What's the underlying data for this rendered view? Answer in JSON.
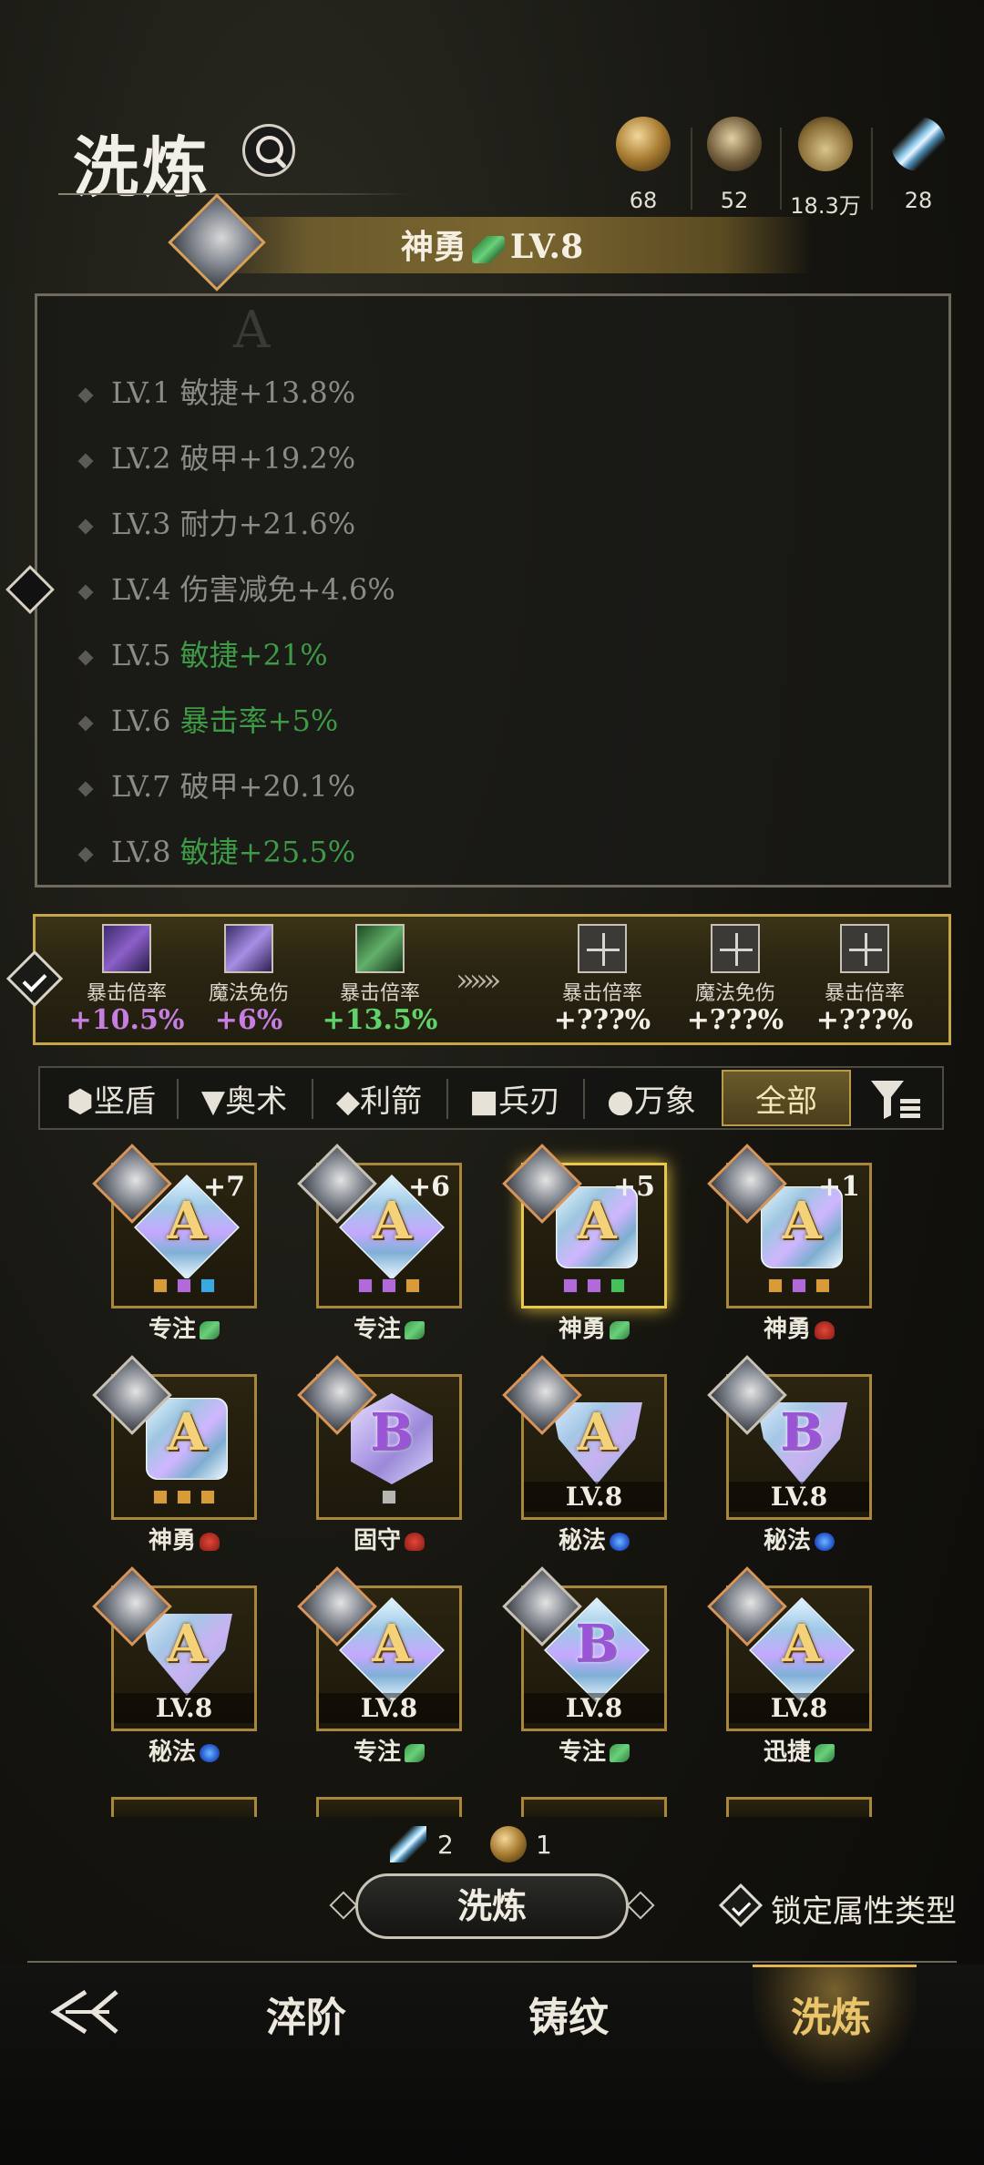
{
  "header": {
    "title": "洗炼"
  },
  "resources": [
    {
      "icon": "ore-gold-icon",
      "value": "68"
    },
    {
      "icon": "ore-dark-icon",
      "value": "52"
    },
    {
      "icon": "potion-icon",
      "value": "18.3万"
    },
    {
      "icon": "feather-icon",
      "value": "28"
    }
  ],
  "banner": {
    "name": "神勇",
    "level": "LV.8"
  },
  "stats": {
    "watermark": "A",
    "rows": [
      {
        "lv": "LV.1",
        "attr": "敏捷+13.8%",
        "green": false
      },
      {
        "lv": "LV.2",
        "attr": "破甲+19.2%",
        "green": false
      },
      {
        "lv": "LV.3",
        "attr": "耐力+21.6%",
        "green": false
      },
      {
        "lv": "LV.4",
        "attr": "伤害减免+4.6%",
        "green": false
      },
      {
        "lv": "LV.5",
        "attr": "敏捷+21%",
        "green": true
      },
      {
        "lv": "LV.6",
        "attr": "暴击率+5%",
        "green": true
      },
      {
        "lv": "LV.7",
        "attr": "破甲+20.1%",
        "green": false
      },
      {
        "lv": "LV.8",
        "attr": "敏捷+25.5%",
        "green": true
      }
    ]
  },
  "compare": {
    "current": [
      {
        "label": "暴击倍率",
        "value": "+10.5%",
        "color": "#c77ee0"
      },
      {
        "label": "魔法免伤",
        "value": "+6%",
        "color": "#c77ee0"
      },
      {
        "label": "暴击倍率",
        "value": "+13.5%",
        "color": "#5fd26a"
      }
    ],
    "arrows": "»»»",
    "preview": [
      {
        "label": "暴击倍率",
        "value": "+???%"
      },
      {
        "label": "魔法免伤",
        "value": "+???%"
      },
      {
        "label": "暴击倍率",
        "value": "+???%"
      }
    ]
  },
  "filters": {
    "tabs": [
      "⬢坚盾",
      "▼奥术",
      "◆利箭",
      "■兵刃",
      "●万象",
      "全部"
    ],
    "active": "全部"
  },
  "gems": [
    {
      "letter": "A",
      "plus": "+7",
      "name": "专注",
      "rune": "green"
    },
    {
      "letter": "A",
      "plus": "+6",
      "name": "专注",
      "rune": "green"
    },
    {
      "letter": "A",
      "plus": "+5",
      "name": "神勇",
      "rune": "green"
    },
    {
      "letter": "A",
      "plus": "+1",
      "name": "神勇",
      "rune": "red"
    },
    {
      "letter": "A",
      "plus": "",
      "name": "神勇",
      "rune": "red"
    },
    {
      "letter": "B",
      "plus": "",
      "name": "固守",
      "rune": "red"
    },
    {
      "letter": "A",
      "lv": "LV.8",
      "name": "秘法",
      "rune": "blue"
    },
    {
      "letter": "B",
      "lv": "LV.8",
      "name": "秘法",
      "rune": "blue"
    },
    {
      "letter": "A",
      "lv": "LV.8",
      "name": "秘法",
      "rune": "blue"
    },
    {
      "letter": "A",
      "lv": "LV.8",
      "name": "专注",
      "rune": "green"
    },
    {
      "letter": "B",
      "lv": "LV.8",
      "name": "专注",
      "rune": "green"
    },
    {
      "letter": "A",
      "lv": "LV.8",
      "name": "迅捷",
      "rune": "green"
    }
  ],
  "cost": {
    "feather": "2",
    "ore": "1"
  },
  "actions": {
    "refine": "洗炼",
    "lock_label": "锁定属性类型"
  },
  "nav": {
    "items": [
      "淬阶",
      "铸纹",
      "洗炼"
    ],
    "active": "洗炼"
  }
}
